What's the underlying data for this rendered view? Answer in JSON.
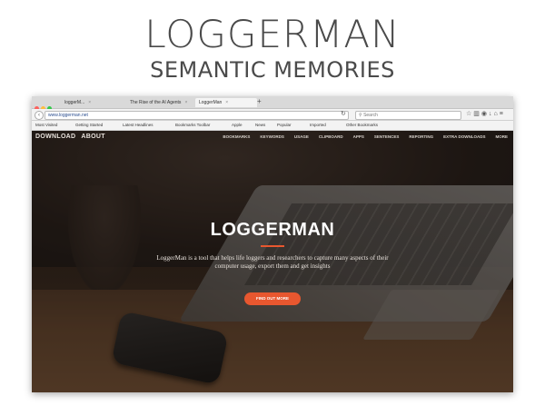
{
  "slide": {
    "title": "LOGGERMAN",
    "subtitle": "SEMANTIC MEMORIES"
  },
  "browser": {
    "tabs": [
      {
        "label": "loggerM..."
      },
      {
        "label": "The Rise of the AI Agents"
      },
      {
        "label": "LoggerMan"
      }
    ],
    "url": "www.loggerman.net",
    "search_placeholder": "Search",
    "toolbar_icons": [
      "bookmark-star-icon",
      "library-icon",
      "pocket-icon",
      "download-icon",
      "home-icon",
      "menu-icon"
    ],
    "bookmarks": [
      "Most Visited",
      "Getting Started",
      "Latest Headlines",
      "Bookmarks Toolbar",
      "Apple",
      "News",
      "Popular",
      "Imported",
      "Other Bookmarks"
    ]
  },
  "site": {
    "brand_links": [
      "DOWNLOAD",
      "ABOUT"
    ],
    "nav": [
      "BOOKMARKS",
      "KEYWORDS",
      "USAGE",
      "CLIPBOARD",
      "APPS",
      "SENTENCES",
      "REPORTING",
      "EXTRA DOWNLOADS",
      "MORE"
    ],
    "hero_title": "LOGGERMAN",
    "hero_text": "LoggerMan is a tool that helps life loggers and researchers to capture many aspects of their computer usage, export them and get insights",
    "cta_label": "FIND OUT MORE",
    "accent": "#e8572f"
  }
}
